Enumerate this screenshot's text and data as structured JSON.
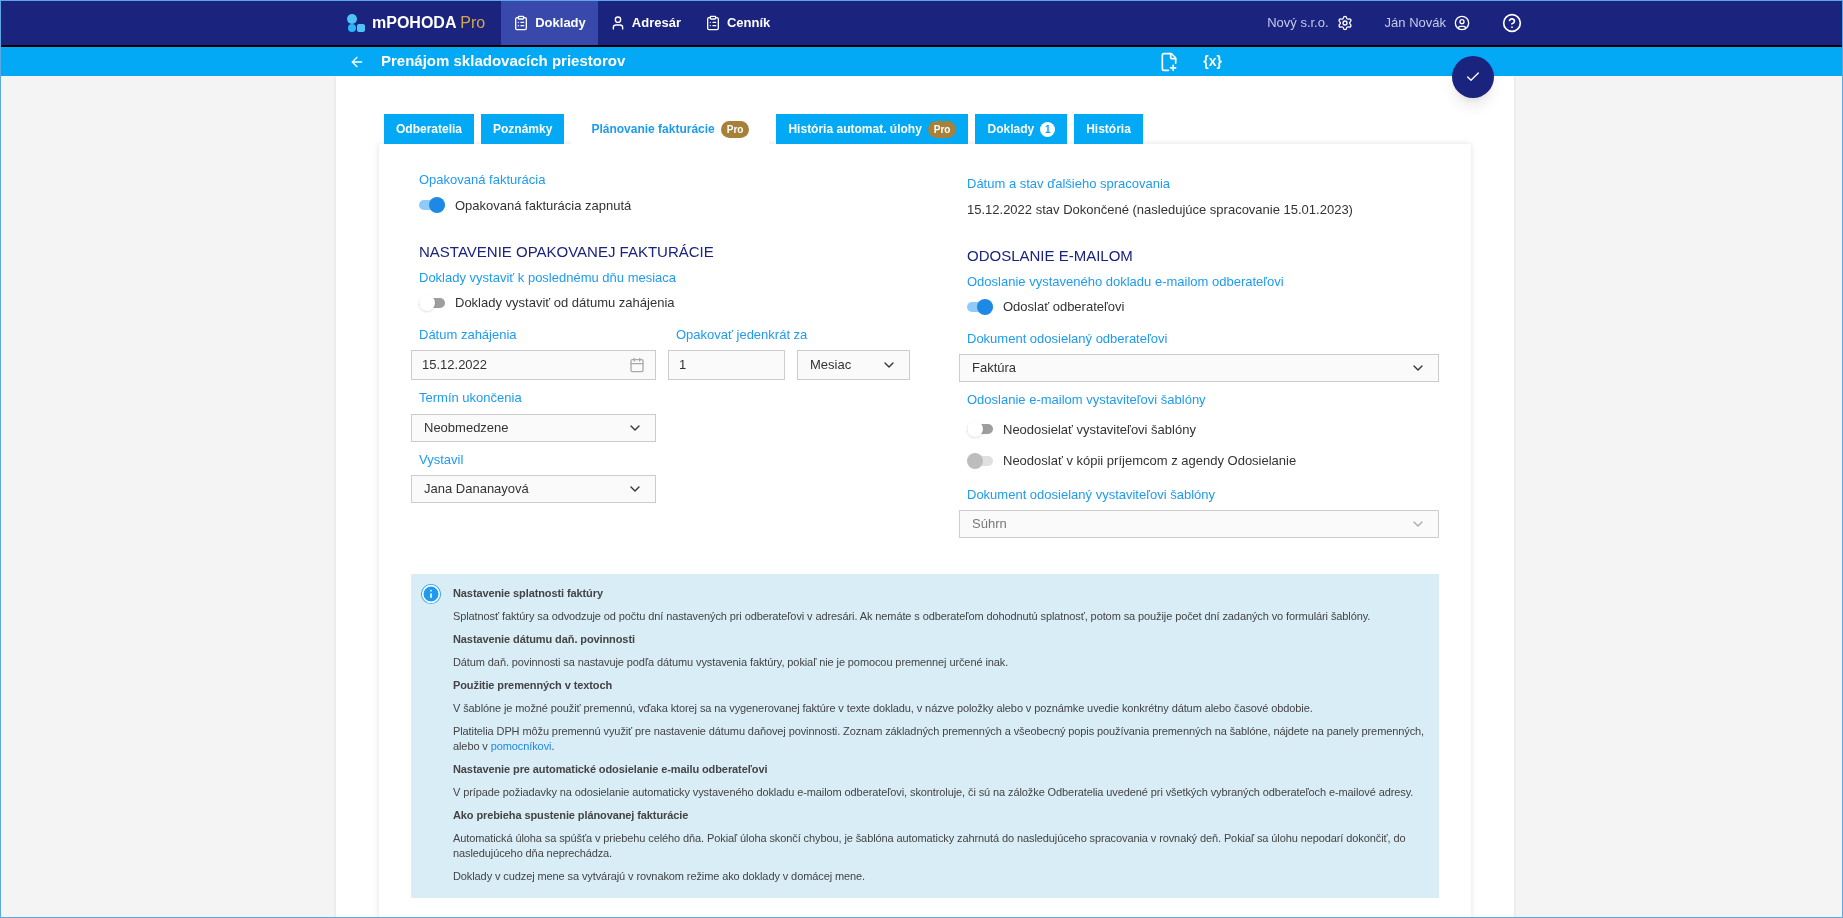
{
  "nav": {
    "logo": "mPOHODA",
    "logo_suffix": "Pro",
    "items": [
      {
        "label": "Doklady",
        "selected": true
      },
      {
        "label": "Adresár",
        "selected": false
      },
      {
        "label": "Cenník",
        "selected": false
      }
    ],
    "company": "Nový s.r.o.",
    "user": "Ján Novák"
  },
  "header": {
    "title": "Prenájom skladovacích priestorov",
    "variables_symbol": "{x}"
  },
  "tabs": [
    {
      "label": "Odberatelia",
      "selected": false
    },
    {
      "label": "Poznámky",
      "selected": false
    },
    {
      "label": "Plánovanie fakturácie",
      "selected": true,
      "badge": "Pro"
    },
    {
      "label": "História automat. úlohy",
      "selected": false,
      "badge": "Pro"
    },
    {
      "label": "Doklady",
      "selected": false,
      "count": "1"
    },
    {
      "label": "História",
      "selected": false
    }
  ],
  "recurring": {
    "label": "Opakovaná fakturácia",
    "toggle": {
      "label": "Opakovaná fakturácia zapnutá",
      "on": true,
      "disabled": false
    }
  },
  "next_processing": {
    "label": "Dátum a stav ďalšieho spracovania",
    "value": "15.12.2022 stav Dokončené (nasledujúce spracovanie 15.01.2023)"
  },
  "settings": {
    "title": "NASTAVENIE OPAKOVANEJ FAKTURÁCIE",
    "subtitle": "Doklady vystaviť k poslednému dňu mesiaca",
    "toggle": {
      "label": "Doklady vystaviť od dátumu zahájenia",
      "on": false,
      "disabled": false
    },
    "start_date": {
      "label": "Dátum zahájenia",
      "value": "15.12.2022"
    },
    "repeat": {
      "label": "Opakovať jedenkrát za",
      "value": "1",
      "unit": "Mesiac"
    },
    "end": {
      "label": "Termín ukončenia",
      "value": "Neobmedzene"
    },
    "issuer": {
      "label": "Vystavil",
      "value": "Jana Dananayová"
    }
  },
  "email": {
    "title": "ODOSLANIE E-MAILOM",
    "subtitle": "Odoslanie vystaveného dokladu e-mailom odberateľovi",
    "toggle": {
      "label": "Odoslať odberateľovi",
      "on": true,
      "disabled": false
    },
    "document": {
      "label": "Dokument odosielaný odberateľovi",
      "value": "Faktúra",
      "disabled": false
    },
    "template_label": "Odoslanie e-mailom vystaviteľovi šablóny",
    "template_toggles": [
      {
        "label": "Neodosielať vystaviteľovi šablóny",
        "on": false,
        "disabled": false
      },
      {
        "label": "Neodoslať v kópii príjemcom z agendy Odosielanie",
        "on": false,
        "disabled": true
      }
    ],
    "template_document": {
      "label": "Dokument odosielaný vystaviteľovi šablóny",
      "value": "Súhrn",
      "disabled": true
    }
  },
  "info": [
    {
      "kind": "heading",
      "text": "Nastavenie splatnosti faktúry"
    },
    {
      "kind": "text",
      "text": "Splatnosť faktúry sa odvodzuje od počtu dní nastavených pri odberateľovi v adresári. Ak nemáte s odberateľom dohodnutú splatnosť, potom sa použije počet dní zadaných vo formulári šablóny."
    },
    {
      "kind": "heading",
      "text": "Nastavenie dátumu daň. povinnosti"
    },
    {
      "kind": "text",
      "text": "Dátum daň. povinnosti sa nastavuje podľa dátumu vystavenia faktúry, pokiaľ nie je pomocou premennej určené inak."
    },
    {
      "kind": "heading",
      "text": "Použitie premenných v textoch"
    },
    {
      "kind": "text",
      "text": "V šablóne je možné použiť premennú, vďaka ktorej sa na vygenerovanej faktúre v texte dokladu, v názve položky alebo v poznámke uvedie konkrétny dátum alebo časové obdobie."
    },
    {
      "kind": "link_text",
      "text": "Platitelia DPH môžu premennú využiť pre nastavenie dátumu daňovej povinnosti. Zoznam základných premenných a všeobecný popis používania premenných na šablóne, nájdete na panely premenných, alebo v ",
      "link": "pomocníkovi",
      "after": "."
    },
    {
      "kind": "heading",
      "text": "Nastavenie pre automatické odosielanie e-mailu odberateľovi"
    },
    {
      "kind": "text",
      "text": "V prípade požiadavky na odosielanie automaticky vystaveného dokladu e-mailom odberateľovi, skontroluje, či sú na záložke Odberatelia uvedené pri všetkých vybraných odberateľoch e-mailové adresy."
    },
    {
      "kind": "heading",
      "text": "Ako prebieha spustenie plánovanej fakturácie"
    },
    {
      "kind": "text",
      "text": "Automatická úloha sa spúšťa v priebehu celého dňa. Pokiaľ úloha skončí chybou, je šablóna automaticky zahrnutá do nasledujúceho spracovania v rovnaký deň. Pokiaľ sa úlohu nepodarí dokončiť, do nasledujúceho dňa neprechádza."
    },
    {
      "kind": "text",
      "text": "Doklady v cudzej mene sa vytvárajú v rovnakom režime ako doklady v domácej mene."
    }
  ]
}
